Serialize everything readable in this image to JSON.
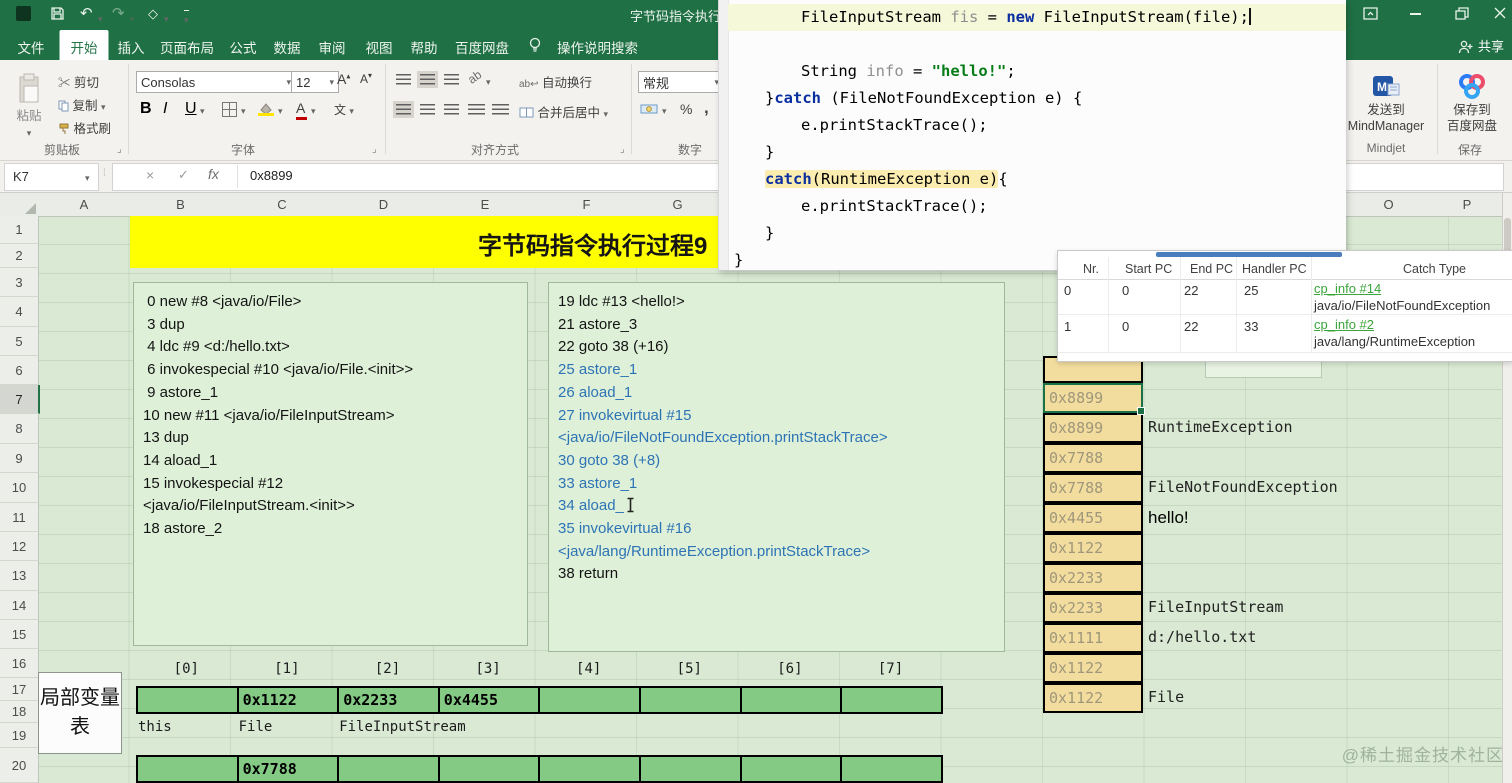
{
  "window": {
    "title": "字节码指令执行",
    "share_label": "共享"
  },
  "menu": {
    "tabs": [
      "文件",
      "开始",
      "插入",
      "页面布局",
      "公式",
      "数据",
      "审阅",
      "视图",
      "帮助",
      "百度网盘"
    ],
    "active_tab": "开始",
    "search_label": "操作说明搜索"
  },
  "ribbon": {
    "clipboard": {
      "group_label": "剪贴板",
      "paste_label": "粘贴",
      "cut_label": "剪切",
      "copy_label": "复制",
      "painter_label": "格式刷"
    },
    "font": {
      "group_label": "字体",
      "font_name": "Consolas",
      "font_size": "12",
      "bold": "B",
      "italic": "I",
      "underline": "U",
      "phonetic": "文"
    },
    "alignment": {
      "group_label": "对齐方式",
      "wrap_label": "自动换行",
      "merge_label": "合并后居中"
    },
    "number": {
      "group_label": "数字",
      "format_value": "常规",
      "percent": "%",
      "comma": ","
    },
    "mindjet": {
      "group_label": "Mindjet",
      "line1": "发送到",
      "line2": "MindManager"
    },
    "baidu": {
      "group_label": "保存",
      "line1": "保存到",
      "line2": "百度网盘"
    }
  },
  "formula_bar": {
    "name_box": "K7",
    "formula": "0x8899",
    "fx": "fx"
  },
  "sheet": {
    "col_headers_left": [
      "A",
      "B",
      "C",
      "D",
      "E",
      "F",
      "G"
    ],
    "col_headers_right": [
      "O",
      "P"
    ],
    "row_headers": [
      "1",
      "2",
      "3",
      "4",
      "5",
      "6",
      "7",
      "8",
      "9",
      "10",
      "11",
      "12",
      "13",
      "14",
      "15",
      "16",
      "17",
      "18",
      "19",
      "20"
    ],
    "selected_row": "7",
    "banner_title": "字节码指令执行过程9",
    "watermark": "@稀土掘金技术社区"
  },
  "bytecode_left": [
    " 0 new #8 <java/io/File>",
    " 3 dup",
    " 4 ldc #9 <d:/hello.txt>",
    " 6 invokespecial #10 <java/io/File.<init>>",
    " 9 astore_1",
    "10 new #11 <java/io/FileInputStream>",
    "13 dup",
    "14 aload_1",
    "15 invokespecial #12",
    "<java/io/FileInputStream.<init>>",
    "18 astore_2"
  ],
  "bytecode_right": [
    {
      "text": "19 ldc #13 <hello!>",
      "color": "black"
    },
    {
      "text": "21 astore_3",
      "color": "black"
    },
    {
      "text": "22 goto 38 (+16)",
      "color": "black"
    },
    {
      "text": "25 astore_1",
      "color": "blue"
    },
    {
      "text": "26 aload_1",
      "color": "blue"
    },
    {
      "text": "27 invokevirtual #15",
      "color": "blue"
    },
    {
      "text": "<java/io/FileNotFoundException.printStackTrace>",
      "color": "blue"
    },
    {
      "text": "30 goto 38 (+8)",
      "color": "blue"
    },
    {
      "text": "33 astore_1",
      "color": "blue"
    },
    {
      "text": "34 aload_",
      "color": "blue",
      "cursor": true
    },
    {
      "text": "35 invokevirtual #16",
      "color": "blue"
    },
    {
      "text": "<java/lang/RuntimeException.printStackTrace>",
      "color": "blue"
    },
    {
      "text": "38 return",
      "color": "black"
    }
  ],
  "local_var_table": {
    "label": "局部变量表",
    "index_headers": [
      "[0]",
      "[1]",
      "[2]",
      "[3]",
      "[4]",
      "[5]",
      "[6]",
      "[7]"
    ],
    "row1_values": [
      "",
      "0x1122",
      "0x2233",
      "0x4455",
      "",
      "",
      "",
      ""
    ],
    "row1_labels": [
      {
        "text": "this",
        "col": 0
      },
      {
        "text": "File",
        "col": 1
      },
      {
        "text": "FileInputStream",
        "col": 2
      }
    ],
    "row2_values": [
      "",
      "0x7788",
      "",
      "",
      "",
      "",
      "",
      ""
    ]
  },
  "stack": {
    "cells": [
      {
        "value": "0x8899",
        "label": "",
        "selected": true
      },
      {
        "value": "0x8899",
        "label": "RuntimeException"
      },
      {
        "value": "0x7788",
        "label": ""
      },
      {
        "value": "0x7788",
        "label": "FileNotFoundException"
      },
      {
        "value": "0x4455",
        "label": "hello!",
        "label_style": "plain"
      },
      {
        "value": "0x1122",
        "label": ""
      },
      {
        "value": "0x2233",
        "label": ""
      },
      {
        "value": "0x2233",
        "label": "FileInputStream"
      },
      {
        "value": "0x1111",
        "label": "d:/hello.txt"
      },
      {
        "value": "0x1122",
        "label": ""
      },
      {
        "value": "0x1122",
        "label": "File"
      }
    ]
  },
  "code_editor": {
    "lines": [
      {
        "indent": 2,
        "caret_line": true,
        "caret": true,
        "segments": [
          {
            "t": "FileInputStream ",
            "c": "plain"
          },
          {
            "t": "fis ",
            "c": "var"
          },
          {
            "t": "= ",
            "c": "plain"
          },
          {
            "t": "new",
            "c": "kw"
          },
          {
            "t": " FileInputStream(file);",
            "c": "plain"
          }
        ]
      },
      {
        "indent": 0,
        "segments": []
      },
      {
        "indent": 2,
        "segments": [
          {
            "t": "String ",
            "c": "plain"
          },
          {
            "t": "info ",
            "c": "var"
          },
          {
            "t": "= ",
            "c": "plain"
          },
          {
            "t": "\"hello!\"",
            "c": "str"
          },
          {
            "t": ";",
            "c": "plain"
          }
        ]
      },
      {
        "indent": 1,
        "segments": [
          {
            "t": "}",
            "c": "plain"
          },
          {
            "t": "catch",
            "c": "kw"
          },
          {
            "t": " (FileNotFoundException e) {",
            "c": "plain"
          }
        ]
      },
      {
        "indent": 2,
        "segments": [
          {
            "t": "e.printStackTrace();",
            "c": "plain"
          }
        ]
      },
      {
        "indent": 1,
        "segments": [
          {
            "t": "}",
            "c": "plain"
          }
        ]
      },
      {
        "indent": 1,
        "highlight": true,
        "tail": "{",
        "segments": [
          {
            "t": "catch",
            "c": "kw"
          },
          {
            "t": "(RuntimeException e)",
            "c": "plain"
          }
        ]
      },
      {
        "indent": 2,
        "segments": [
          {
            "t": "e.printStackTrace();",
            "c": "plain"
          }
        ]
      },
      {
        "indent": 1,
        "segments": [
          {
            "t": "}",
            "c": "plain"
          }
        ]
      },
      {
        "indent": 0,
        "segments": [
          {
            "t": "}",
            "c": "plain"
          }
        ]
      }
    ]
  },
  "exception_table": {
    "headers": [
      "Nr.",
      "Start PC",
      "End PC",
      "Handler PC",
      "Catch Type"
    ],
    "rows": [
      {
        "nr": "0",
        "start_pc": "0",
        "end_pc": "22",
        "handler_pc": "25",
        "cp_link": "cp_info #14",
        "catch_type": "java/io/FileNotFoundException"
      },
      {
        "nr": "1",
        "start_pc": "0",
        "end_pc": "22",
        "handler_pc": "33",
        "cp_link": "cp_info #2",
        "catch_type": "java/lang/RuntimeException"
      }
    ]
  },
  "colors": {
    "excel_green": "#1f7044",
    "sheet_bg": "#d9e9d3",
    "banner_yellow": "#ffff00",
    "box_green": "#def0d8",
    "stack_tan": "#f3dd9e",
    "lvt_green": "#84ca84",
    "bytecode_blue": "#2e74b5",
    "keyword_blue": "#0b2fa0",
    "string_green": "#067d17",
    "link_green": "#3ba53b",
    "highlight_yellow": "#fbecb0"
  }
}
